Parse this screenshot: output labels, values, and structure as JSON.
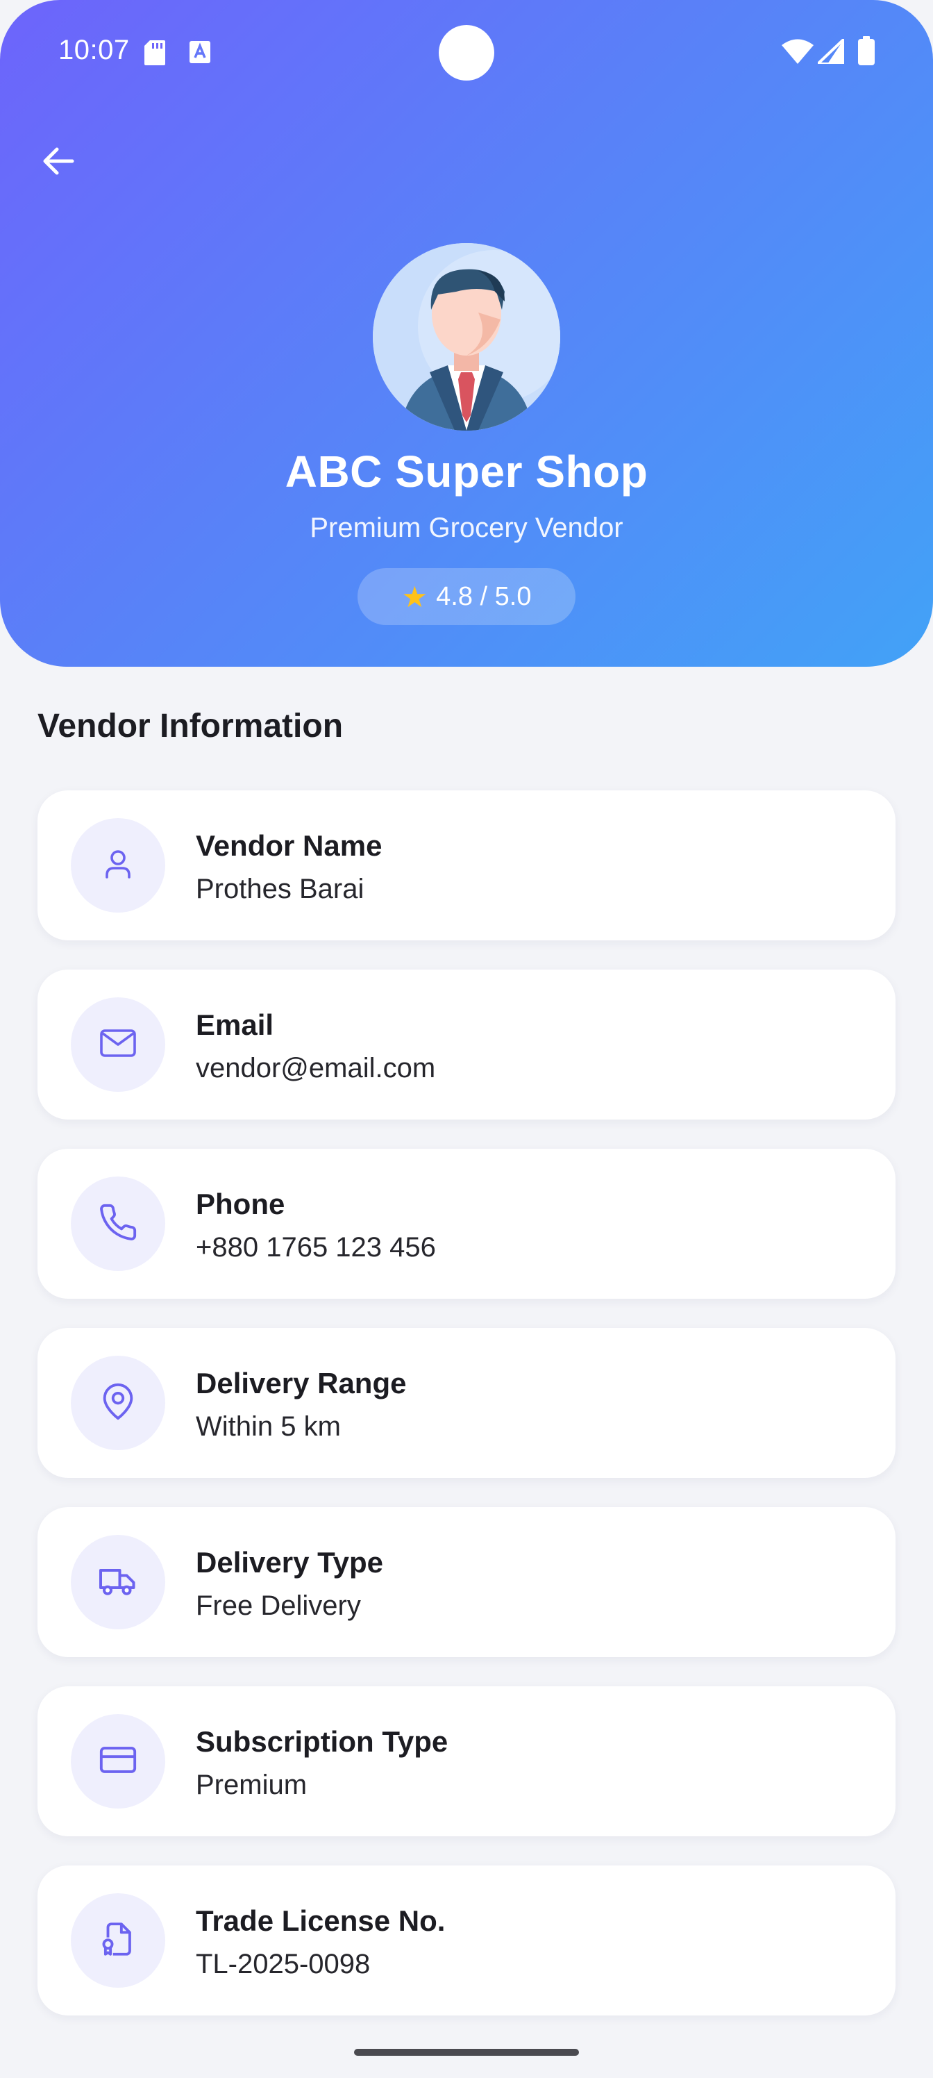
{
  "status_bar": {
    "time": "10:07",
    "icons": [
      "sd-card-icon",
      "a-notification-icon",
      "wifi-icon",
      "cell-signal-icon",
      "battery-icon"
    ]
  },
  "header": {
    "shop_name": "ABC Super Shop",
    "subtitle": "Premium Grocery Vendor",
    "rating": "4.8 / 5.0",
    "rating_icon": "star-icon",
    "back_icon": "arrow-left-icon",
    "gradient": [
      "#6d64fb",
      "#42a2f7"
    ]
  },
  "section": {
    "title": "Vendor Information"
  },
  "items": [
    {
      "label": "Vendor Name",
      "value": "Prothes Barai",
      "icon": "person-icon"
    },
    {
      "label": "Email",
      "value": "vendor@email.com",
      "icon": "mail-icon"
    },
    {
      "label": "Phone",
      "value": "+880 1765 123 456",
      "icon": "phone-icon"
    },
    {
      "label": "Delivery Range",
      "value": "Within 5 km",
      "icon": "location-pin-icon"
    },
    {
      "label": "Delivery Type",
      "value": "Free Delivery",
      "icon": "truck-icon"
    },
    {
      "label": "Subscription Type",
      "value": "Premium",
      "icon": "credit-card-icon"
    },
    {
      "label": "Trade License No.",
      "value": "TL-2025-0098",
      "icon": "license-document-icon"
    }
  ],
  "colors": {
    "accent": "#6c63f0",
    "icon_bg": "#efeffd",
    "page_bg": "#f3f4f8",
    "star": "#ffc21a"
  }
}
